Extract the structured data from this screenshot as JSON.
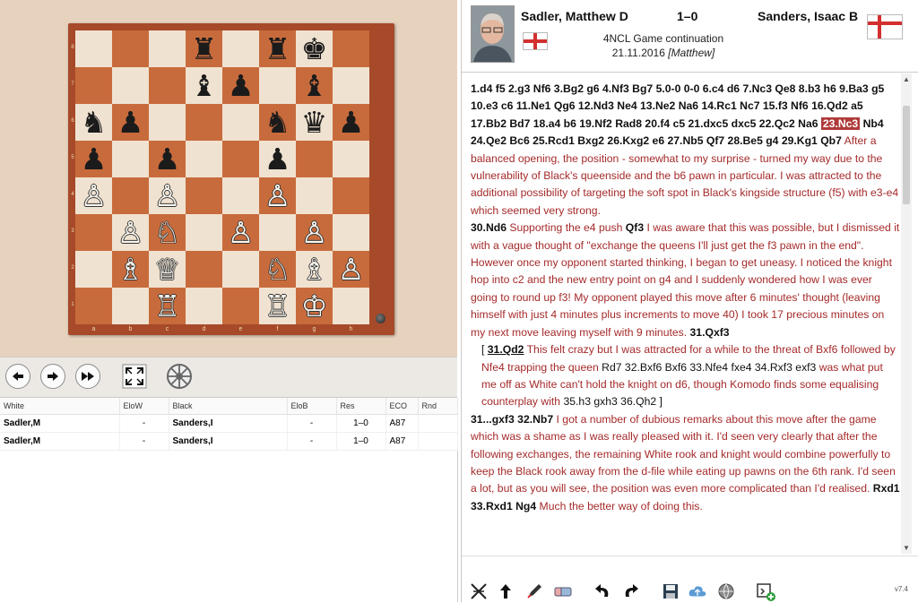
{
  "board": {
    "rank_labels": [
      "8",
      "7",
      "6",
      "5",
      "4",
      "3",
      "2",
      "1"
    ],
    "file_labels": [
      "a",
      "b",
      "c",
      "d",
      "e",
      "f",
      "g",
      "h"
    ],
    "position": [
      [
        "",
        "",
        "",
        "br",
        "",
        "br",
        "bk",
        ""
      ],
      [
        "",
        "",
        "",
        "bb",
        "bp",
        "",
        "bb",
        ""
      ],
      [
        "bn",
        "bp",
        "",
        "",
        "",
        "bn",
        "bq",
        "bp"
      ],
      [
        "bp",
        "",
        "bp",
        "",
        "",
        "bp",
        "",
        ""
      ],
      [
        "wp",
        "",
        "wp",
        "",
        "",
        "wp",
        "",
        ""
      ],
      [
        "",
        "wp",
        "wn",
        "",
        "wp",
        "",
        "wp",
        ""
      ],
      [
        "",
        "wb",
        "wq",
        "",
        "",
        "wn",
        "wb",
        "wp"
      ],
      [
        "",
        "",
        "wr",
        "",
        "",
        "wr",
        "wk",
        ""
      ]
    ],
    "colors": {
      "light": "#f0e2d0",
      "dark": "#c86b3c",
      "frame": "#a64a2a"
    }
  },
  "nav": {
    "buttons": [
      "arrow-left-icon",
      "arrow-right-icon",
      "fast-forward-icon",
      "fullscreen-icon",
      "engine-wheel-icon"
    ]
  },
  "game_list": {
    "columns": [
      "White",
      "EloW",
      "Black",
      "EloB",
      "Res",
      "ECO",
      "Rnd"
    ],
    "rows": [
      [
        "Sadler,M",
        "-",
        "Sanders,I",
        "-",
        "1–0",
        "A87",
        ""
      ],
      [
        "Sadler,M",
        "-",
        "Sanders,I",
        "-",
        "1–0",
        "A87",
        ""
      ]
    ]
  },
  "header": {
    "white": "Sadler, Matthew D",
    "result": "1–0",
    "black": "Sanders, Isaac B",
    "event": "4NCL Game continuation",
    "date": "21.11.2016",
    "annotator": "[Matthew]"
  },
  "notation": {
    "opening": "1.d4 f5 2.g3 Nf6 3.Bg2 g6 4.Nf3 Bg7 5.0-0 0-0 6.c4 d6 7.Nc3 Qe8 8.b3 h6 9.Ba3 g5 10.e3 c6 11.Ne1 Qg6 12.Nd3 Ne4 13.Ne2 Na6 14.Rc1 Nc7 15.f3 Nf6 16.Qd2 a5 17.Bb2 Bd7 18.a4 b6 19.Nf2 Rad8 20.f4 c5 21.dxc5 dxc5 22.Qc2 Na6",
    "current_move": "23.Nc3",
    "moves_after": "Nb4 24.Qe2 Bc6 25.Rcd1 Bxg2 26.Kxg2 e6 27.Nb5 Qf7 28.Be5 g4 29.Kg1 Qb7",
    "comment1": "After a balanced opening, the position - somewhat to my surprise - turned my way due to the vulnerability of Black's queenside and the b6 pawn in particular. I was attracted to the additional possibility of targeting the soft spot in Black's kingside structure (f5) with e3-e4 which seemed very strong.",
    "move30": "30.Nd6",
    "comment2": "Supporting the e4 push",
    "move30b": "Qf3",
    "comment3": "I was aware that this was possible, but I dismissed it with a vague thought of \"exchange the queens I'll just get the f3 pawn in the end\". However once my opponent started thinking, I began to get uneasy. I noticed the knight hop into c2 and the new entry point on g4 and I suddenly wondered how I was ever going to round up f3! My opponent played this move after 6 minutes' thought (leaving himself with just 4 minutes plus increments to move 40) I took 17 precious minutes on my next move leaving myself with 9 minutes.",
    "move31": "31.Qxf3",
    "var_open": "[",
    "var_move": "31.Qd2",
    "var_comment1": "This felt crazy but I was attracted for a while to the threat of Bxf6 followed by Nfe4 trapping the queen",
    "var_moves1": "Rd7 32.Bxf6 Bxf6 33.Nfe4 fxe4 34.Rxf3 exf3",
    "var_comment2": "was what put me off as White can't hold the knight on d6, though Komodo finds some equalising counterplay with",
    "var_moves2": "35.h3 gxh3 36.Qh2",
    "var_close": "]",
    "move31b": "31...gxf3 32.Nb7",
    "comment4": "I got a number of dubious remarks about this move after the game which was a shame as I was really pleased with it. I'd seen very clearly that after the following exchanges, the remaining White rook and knight would combine powerfully to keep the Black rook away from the d-file while eating up pawns on the 6th rank. I'd seen a lot, but as you will see, the position was even more complicated than I'd realised.",
    "move33": "Rxd1 33.Rxd1 Ng4",
    "comment5": "Much the better way of doing this."
  },
  "toolbar": {
    "icons": [
      "delete-variation-icon",
      "promote-variation-icon",
      "annotate-pen-icon",
      "eraser-icon",
      "undo-icon",
      "redo-icon",
      "save-icon",
      "upload-cloud-icon",
      "globe-icon",
      "new-game-icon"
    ],
    "version": "v7.4"
  }
}
